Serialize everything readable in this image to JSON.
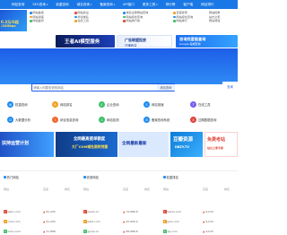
{
  "topnav": {
    "items": [
      {
        "label": "网站查询",
        "caret": true
      },
      {
        "label": "SEO查询",
        "caret": true
      },
      {
        "label": "权重查询",
        "caret": false
      },
      {
        "label": "域名查询",
        "caret": true
      },
      {
        "label": "备案查询",
        "caret": true
      },
      {
        "label": "API接口",
        "caret": false
      },
      {
        "label": "更多工具",
        "caret": true
      },
      {
        "label": "排行榜",
        "caret": false
      },
      {
        "label": "客户端",
        "caret": false
      },
      {
        "label": "网站排行",
        "caret": false
      }
    ]
  },
  "promo_left": {
    "line1": "0.3元/G起",
    "line2": "/20Gbps"
  },
  "links": {
    "col1": [
      "网站备案",
      "网站测速",
      "网站备份"
    ],
    "col2": [
      "网站建设",
      "测试域名",
      "站长工具"
    ],
    "col3": [
      "域名注册网站查询",
      "网站综合查询",
      "网站排行榜"
    ],
    "col4": [
      "百度收录",
      "网站综合查询",
      "网站排行"
    ],
    "col5": [
      "网站权重",
      "站长之家",
      "网站测速"
    ]
  },
  "banners": {
    "b1": "王者AI模型服务",
    "b2_title": "广告联盟投放",
    "b2_sub": "日赚收益",
    "b3_title": "咨询找客服查询",
    "b3_sub": "Google 权威查询"
  },
  "search": {
    "placeholder": "请输入你要查询的网站",
    "button": "综合查询",
    "side_button": "查询"
  },
  "tiles": [
    {
      "label": "权重查询",
      "color": "#1d8cf0",
      "icon": "W"
    },
    {
      "label": "网站排名",
      "color": "#f0a020",
      "icon": "R"
    },
    {
      "label": "企业查询",
      "color": "#3dbf6a",
      "icon": "E"
    },
    {
      "label": "网站测速",
      "color": "#1d8cf0",
      "icon": "S"
    },
    {
      "label": "在线工具",
      "color": "#7c5cf0",
      "icon": "T"
    },
    {
      "label": "大数据分析",
      "color": "#1d8cf0",
      "icon": "D"
    },
    {
      "label": "综合信息查询",
      "color": "#f06a30",
      "icon": "I"
    },
    {
      "label": "网站检测",
      "color": "#3dbf6a",
      "icon": "C"
    },
    {
      "label": "备案查询系统",
      "color": "#1d8cf0",
      "icon": "B"
    },
    {
      "label": "过期数据查询",
      "color": "#e0463a",
      "icon": "X"
    }
  ],
  "ads": {
    "a1": "扶持运营计划",
    "a2_title": "全网最高提单额度",
    "a2_sub": "大厂COM域名限时特惠",
    "a3": "全网最新最新",
    "a4_title": "豆瓣资源",
    "a4_sub": "DBZY.TV",
    "a5_title": "免费考站",
    "a5_sub": "站长之家专享"
  },
  "tabs": [
    {
      "label": "热门网站"
    },
    {
      "label": "收录网站"
    },
    {
      "label": "权重排名"
    }
  ],
  "rank": {
    "headers": [
      "网站",
      "百度",
      "排名",
      "网站",
      "百度",
      "排名",
      "网站",
      "百度",
      "排名"
    ],
    "rows": [
      {
        "c1": "qqtn.com",
        "c2": "81,205",
        "c3": "jiaotu.cn",
        "c4": "74,888,8",
        "c5": "baidu.com",
        "c6": "9,015"
      },
      {
        "c1": "cnzz.com",
        "c2": "81,205",
        "c3": "pet2.com",
        "c4": "45,600,0",
        "c5": "jjwx.com",
        "c6": "9,015"
      },
      {
        "c1": "sohu.com",
        "c2": "21,888",
        "c3": "goole.cn",
        "c4": "88,888,8",
        "c5": "qq.com",
        "c6": "9,015"
      }
    ]
  }
}
